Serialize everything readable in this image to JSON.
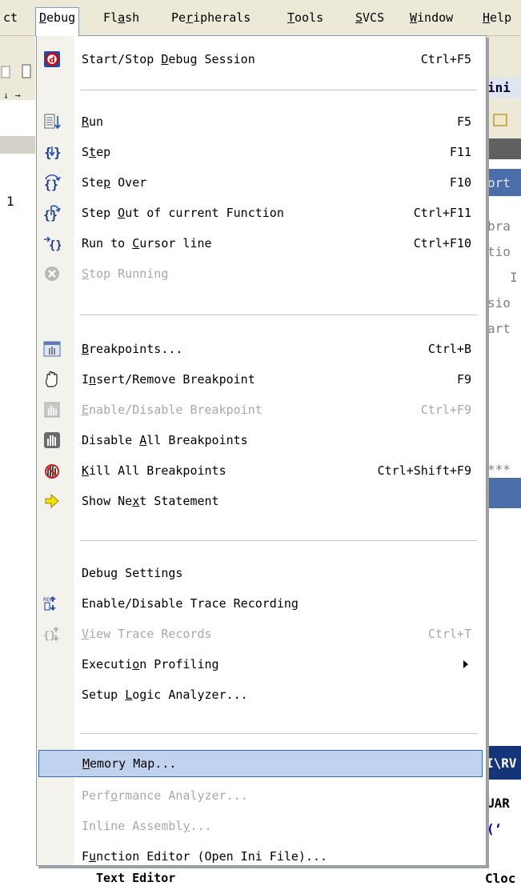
{
  "menubar": {
    "items": [
      {
        "pre": "ct",
        "u": "",
        "post": ""
      },
      {
        "pre": "",
        "u": "D",
        "post": "ebug"
      },
      {
        "pre": "Fl",
        "u": "a",
        "post": "sh"
      },
      {
        "pre": "Pe",
        "u": "r",
        "post": "ipherals"
      },
      {
        "pre": "",
        "u": "T",
        "post": "ools"
      },
      {
        "pre": "",
        "u": "S",
        "post": "VCS"
      },
      {
        "pre": "",
        "u": "W",
        "post": "indow"
      },
      {
        "pre": "",
        "u": "H",
        "post": "elp"
      }
    ]
  },
  "menu": {
    "items": [
      {
        "pre": "Start/Stop ",
        "u": "D",
        "post": "ebug Session",
        "shortcut": "Ctrl+F5",
        "icon": "debug-session-icon"
      },
      {
        "pre": "",
        "u": "R",
        "post": "un",
        "shortcut": "F5",
        "icon": "run-icon"
      },
      {
        "pre": "S",
        "u": "t",
        "post": "ep",
        "shortcut": "F11",
        "icon": "step-icon"
      },
      {
        "pre": "Ste",
        "u": "p",
        "post": " Over",
        "shortcut": "F10",
        "icon": "step-over-icon"
      },
      {
        "pre": "Step ",
        "u": "O",
        "post": "ut of current Function",
        "shortcut": "Ctrl+F11",
        "icon": "step-out-icon"
      },
      {
        "pre": "Run to ",
        "u": "C",
        "post": "ursor line",
        "shortcut": "Ctrl+F10",
        "icon": "run-to-cursor-icon"
      },
      {
        "pre": "",
        "u": "S",
        "post": "top Running",
        "shortcut": "",
        "icon": "stop-icon"
      },
      {
        "pre": "",
        "u": "B",
        "post": "reakpoints...",
        "shortcut": "Ctrl+B",
        "icon": "breakpoints-icon"
      },
      {
        "pre": "I",
        "u": "n",
        "post": "sert/Remove Breakpoint",
        "shortcut": "F9",
        "icon": "insert-breakpoint-icon"
      },
      {
        "pre": "",
        "u": "E",
        "post": "nable/Disable Breakpoint",
        "shortcut": "Ctrl+F9",
        "icon": "enable-breakpoint-icon"
      },
      {
        "pre": "Disable ",
        "u": "A",
        "post": "ll Breakpoints",
        "shortcut": "",
        "icon": "disable-all-breakpoints-icon"
      },
      {
        "pre": "",
        "u": "K",
        "post": "ill All Breakpoints",
        "shortcut": "Ctrl+Shift+F9",
        "icon": "kill-breakpoints-icon"
      },
      {
        "pre": "Show Ne",
        "u": "x",
        "post": "t Statement",
        "shortcut": "",
        "icon": "next-statement-icon"
      },
      {
        "pre": "Debug Settings",
        "u": "",
        "post": "",
        "shortcut": "",
        "icon": ""
      },
      {
        "pre": "Enable/Disable Trace Recording",
        "u": "",
        "post": "",
        "shortcut": "",
        "icon": "trace-record-icon"
      },
      {
        "pre": "",
        "u": "V",
        "post": "iew Trace Records",
        "shortcut": "Ctrl+T",
        "icon": "trace-view-icon"
      },
      {
        "pre": "Executi",
        "u": "o",
        "post": "n Profiling",
        "shortcut": "",
        "icon": ""
      },
      {
        "pre": "Setup ",
        "u": "L",
        "post": "ogic Analyzer...",
        "shortcut": "",
        "icon": ""
      },
      {
        "pre": "",
        "u": "M",
        "post": "emory Map...",
        "shortcut": "",
        "icon": ""
      },
      {
        "pre": "Perf",
        "u": "o",
        "post": "rmance Analyzer...",
        "shortcut": "",
        "icon": ""
      },
      {
        "pre": "Inline Assembl",
        "u": "y",
        "post": "...",
        "shortcut": "",
        "icon": ""
      },
      {
        "pre": "F",
        "u": "u",
        "post": "nction Editor (Open Ini File)...",
        "shortcut": "",
        "icon": ""
      }
    ]
  },
  "background": {
    "right_fragments": [
      "ini",
      "ort",
      "bra",
      "tio",
      "I",
      "sio",
      "art",
      "***",
      "I\\RV",
      "UAR",
      "(‘",
      "Cloc"
    ],
    "left_fragments": [
      "1"
    ],
    "bottom_fragment": "Text Editor"
  },
  "colors": {
    "menubar_bg": "#ece9d8",
    "highlight_bg": "#c1d2ee",
    "highlight_border": "#316ac5",
    "disabled_text": "#a8a8a8"
  }
}
